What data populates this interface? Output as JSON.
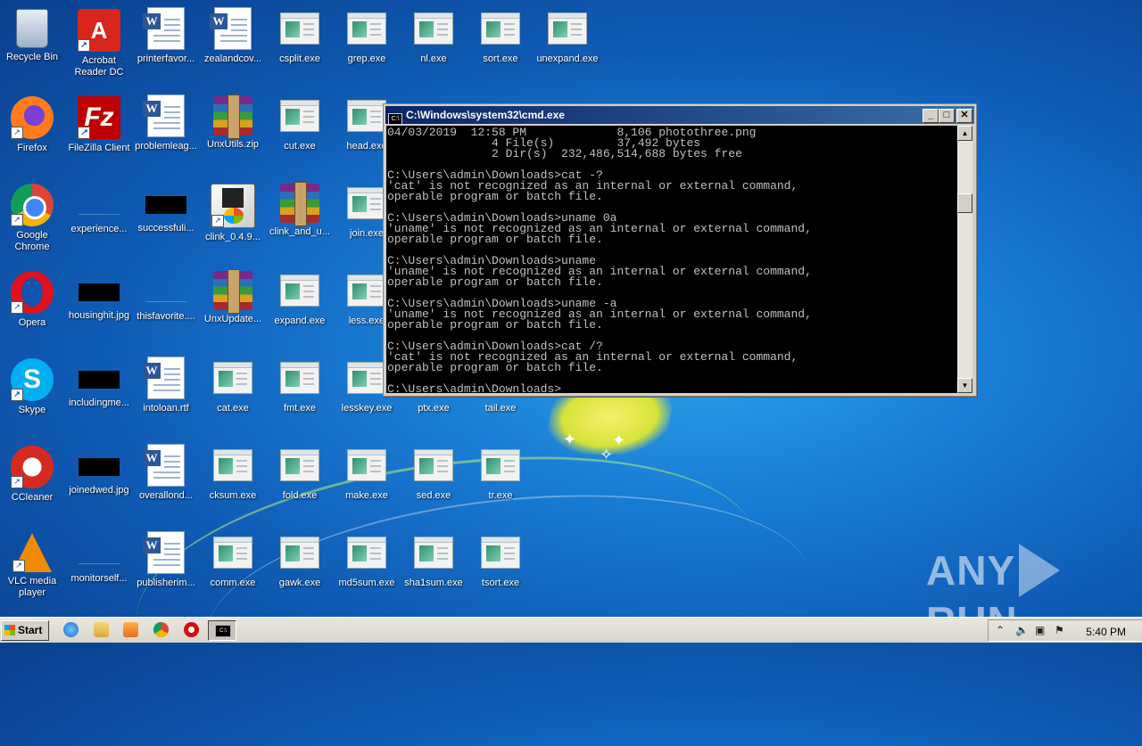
{
  "desktop": {
    "icons": [
      {
        "label": "Recycle Bin",
        "kind": "recycle"
      },
      {
        "label": "Acrobat\nReader DC",
        "kind": "acrobat"
      },
      {
        "label": "printerfavor...",
        "kind": "word"
      },
      {
        "label": "zealandcov...",
        "kind": "word"
      },
      {
        "label": "csplit.exe",
        "kind": "exe"
      },
      {
        "label": "grep.exe",
        "kind": "exe"
      },
      {
        "label": "nl.exe",
        "kind": "exe"
      },
      {
        "label": "sort.exe",
        "kind": "exe"
      },
      {
        "label": "unexpand.exe",
        "kind": "exe"
      },
      {
        "label": "Firefox",
        "kind": "firefox"
      },
      {
        "label": "FileZilla Client",
        "kind": "filezilla"
      },
      {
        "label": "problemleag...",
        "kind": "word"
      },
      {
        "label": "UnxUtils.zip",
        "kind": "rar"
      },
      {
        "label": "cut.exe",
        "kind": "exe"
      },
      {
        "label": "head.exe",
        "kind": "exe"
      },
      {
        "label": "Google\nChrome",
        "kind": "chrome"
      },
      {
        "label": "experience...",
        "kind": "blue"
      },
      {
        "label": "successfuli...",
        "kind": "black"
      },
      {
        "label": "clink_0.4.9...",
        "kind": "installer"
      },
      {
        "label": "clink_and_u...",
        "kind": "rar"
      },
      {
        "label": "join.exe",
        "kind": "exe"
      },
      {
        "label": "Opera",
        "kind": "opera"
      },
      {
        "label": "housinghit.jpg",
        "kind": "black"
      },
      {
        "label": "thisfavorite....",
        "kind": "blue"
      },
      {
        "label": "UnxUpdate...",
        "kind": "rar"
      },
      {
        "label": "expand.exe",
        "kind": "exe"
      },
      {
        "label": "less.exe",
        "kind": "exe"
      },
      {
        "label": "Skype",
        "kind": "skype"
      },
      {
        "label": "includingme...",
        "kind": "black"
      },
      {
        "label": "intoloan.rtf",
        "kind": "word"
      },
      {
        "label": "cat.exe",
        "kind": "exe"
      },
      {
        "label": "fmt.exe",
        "kind": "exe"
      },
      {
        "label": "lesskey.exe",
        "kind": "exe"
      },
      {
        "label": "ptx.exe",
        "kind": "exe"
      },
      {
        "label": "tail.exe",
        "kind": "exe"
      },
      {
        "label": "CCleaner",
        "kind": "ccleaner"
      },
      {
        "label": "joinedwed.jpg",
        "kind": "black"
      },
      {
        "label": "overallond...",
        "kind": "word"
      },
      {
        "label": "cksum.exe",
        "kind": "exe"
      },
      {
        "label": "fold.exe",
        "kind": "exe"
      },
      {
        "label": "make.exe",
        "kind": "exe"
      },
      {
        "label": "sed.exe",
        "kind": "exe"
      },
      {
        "label": "tr.exe",
        "kind": "exe"
      },
      {
        "label": "VLC media\nplayer",
        "kind": "vlc"
      },
      {
        "label": "monitorself...",
        "kind": "blue"
      },
      {
        "label": "publisherim...",
        "kind": "word"
      },
      {
        "label": "comm.exe",
        "kind": "exe"
      },
      {
        "label": "gawk.exe",
        "kind": "exe"
      },
      {
        "label": "md5sum.exe",
        "kind": "exe"
      },
      {
        "label": "sha1sum.exe",
        "kind": "exe"
      },
      {
        "label": "tsort.exe",
        "kind": "exe"
      }
    ]
  },
  "cmd": {
    "title": "C:\\Windows\\system32\\cmd.exe",
    "icon_text": "C:\\",
    "minimize": "_",
    "maximize": "□",
    "close": "✕",
    "scroll_up": "▲",
    "scroll_down": "▼",
    "output": "04/03/2019  12:58 PM             8,106 photothree.png\n               4 File(s)         37,492 bytes\n               2 Dir(s)  232,486,514,688 bytes free\n\nC:\\Users\\admin\\Downloads>cat -?\n'cat' is not recognized as an internal or external command,\noperable program or batch file.\n\nC:\\Users\\admin\\Downloads>uname 0a\n'uname' is not recognized as an internal or external command,\noperable program or batch file.\n\nC:\\Users\\admin\\Downloads>uname\n'uname' is not recognized as an internal or external command,\noperable program or batch file.\n\nC:\\Users\\admin\\Downloads>uname -a\n'uname' is not recognized as an internal or external command,\noperable program or batch file.\n\nC:\\Users\\admin\\Downloads>cat /?\n'cat' is not recognized as an internal or external command,\noperable program or batch file.\n\nC:\\Users\\admin\\Downloads>"
  },
  "taskbar": {
    "start_label": "Start",
    "cmd_task_icon": "C:\\",
    "clock": "5:40 PM",
    "tray_icons": [
      "chevron-up-icon",
      "speaker-icon",
      "network-icon",
      "flag-icon"
    ]
  },
  "watermark": {
    "left": "ANY",
    "right": "RUN"
  }
}
